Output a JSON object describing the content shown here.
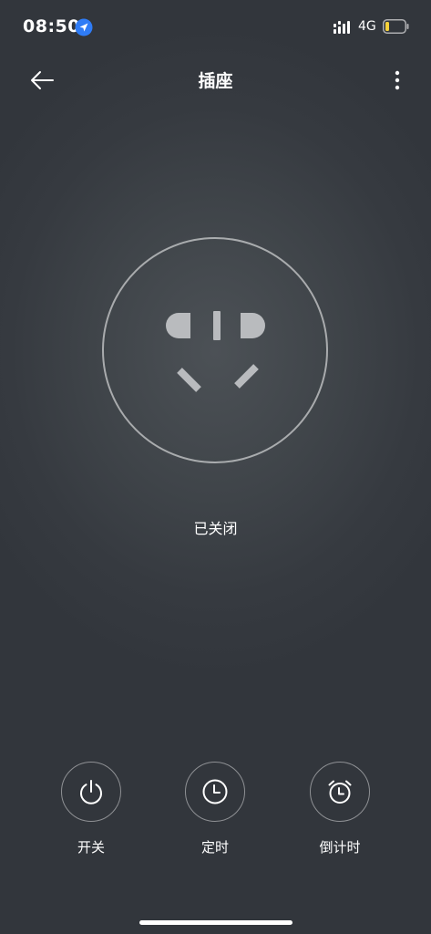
{
  "status_bar": {
    "time": "08:50",
    "network": "4G",
    "location_icon": "location-arrow-icon",
    "signal_icon": "signal-icon",
    "battery_icon": "battery-low-icon",
    "battery_level": 0.2,
    "location_color": "#2f7cf6",
    "battery_color": "#f7d23a"
  },
  "header": {
    "title": "插座",
    "back_icon": "back-arrow-icon",
    "more_icon": "more-vertical-icon"
  },
  "device": {
    "icon": "socket-icon",
    "status": "已关闭"
  },
  "actions": [
    {
      "label": "开关",
      "icon": "power-icon"
    },
    {
      "label": "定时",
      "icon": "clock-icon"
    },
    {
      "label": "倒计时",
      "icon": "alarm-clock-icon"
    }
  ]
}
